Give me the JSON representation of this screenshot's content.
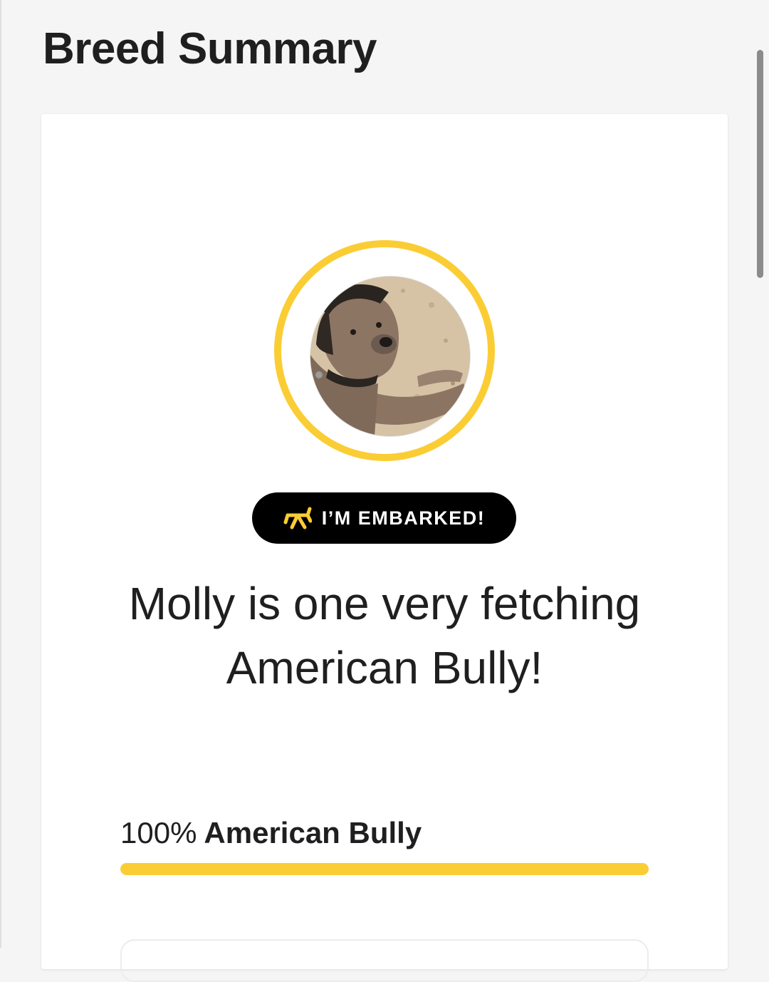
{
  "page": {
    "title": "Breed Summary"
  },
  "summary_card": {
    "photo_icon": "dog-photo",
    "badge": {
      "icon": "balloon-dog-icon",
      "label": "I’M EMBARKED!"
    },
    "headline": "Molly is one very fetching American Bully!",
    "breeds": [
      {
        "percent": "100%",
        "name": "American Bully",
        "fraction": 1.0
      }
    ]
  },
  "colors": {
    "accent_yellow": "#fbcd34",
    "badge_black": "#000000",
    "page_background": "#f5f5f5",
    "card_background": "#ffffff"
  }
}
